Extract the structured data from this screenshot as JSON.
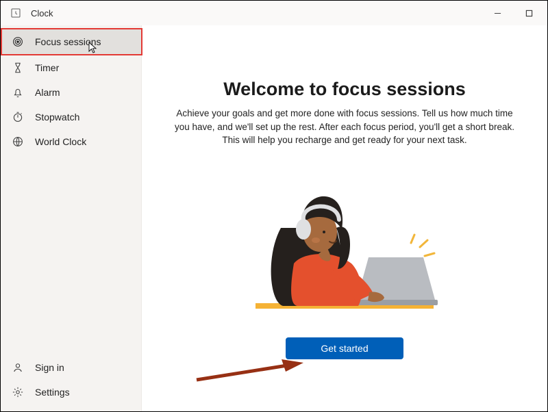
{
  "app": {
    "title": "Clock"
  },
  "sidebar": {
    "items": [
      {
        "label": "Focus sessions",
        "icon": "bullseye-icon",
        "selected": true
      },
      {
        "label": "Timer",
        "icon": "hourglass-icon",
        "selected": false
      },
      {
        "label": "Alarm",
        "icon": "bell-icon",
        "selected": false
      },
      {
        "label": "Stopwatch",
        "icon": "stopwatch-icon",
        "selected": false
      },
      {
        "label": "World Clock",
        "icon": "globe-icon",
        "selected": false
      }
    ],
    "bottom": [
      {
        "label": "Sign in",
        "icon": "person-icon"
      },
      {
        "label": "Settings",
        "icon": "gear-icon"
      }
    ]
  },
  "main": {
    "headline": "Welcome to focus sessions",
    "description": "Achieve your goals and get more done with focus sessions. Tell us how much time you have, and we'll set up the rest. After each focus period, you'll get a short break. This will help you recharge and get ready for your next task.",
    "cta_label": "Get started"
  },
  "colors": {
    "highlight_border": "#e33934",
    "cta_bg": "#005fb8",
    "arrow": "#973014"
  }
}
